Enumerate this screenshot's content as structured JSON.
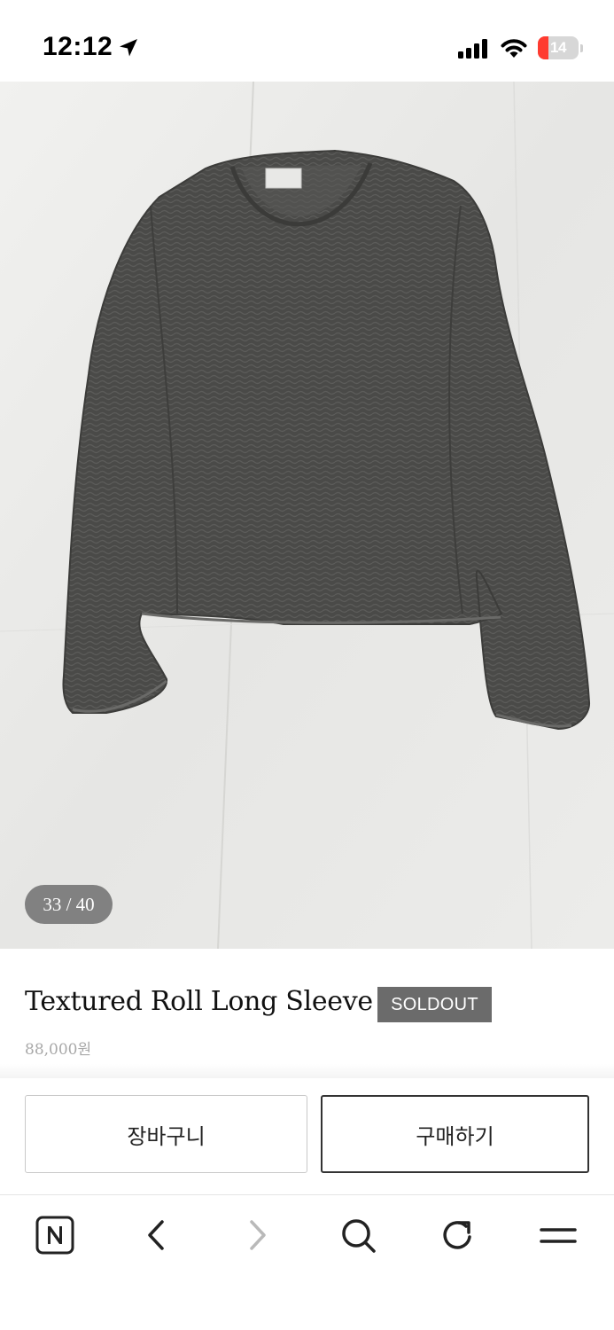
{
  "status_bar": {
    "time": "12:12",
    "battery_text": "14",
    "battery_level": 0.14,
    "battery_color": "#ff3b30",
    "icons": [
      "location-arrow-icon",
      "cellular-signal-icon",
      "wifi-icon",
      "battery-icon"
    ]
  },
  "gallery": {
    "counter": "33 / 40",
    "current": 33,
    "total": 40
  },
  "product": {
    "title": "Textured Roll Long Sleeve",
    "badge": "SOLDOUT",
    "price": "88,000원"
  },
  "actions": {
    "cart_label": "장바구니",
    "buy_label": "구매하기"
  },
  "toolbar": {
    "items": [
      "naver-home-icon",
      "back-icon",
      "forward-icon",
      "search-icon",
      "reload-icon",
      "menu-icon"
    ],
    "forward_enabled": false
  },
  "colors": {
    "badge_bg": "#6b6b6b",
    "price_text": "#a8a8a8",
    "buy_border": "#333333"
  }
}
